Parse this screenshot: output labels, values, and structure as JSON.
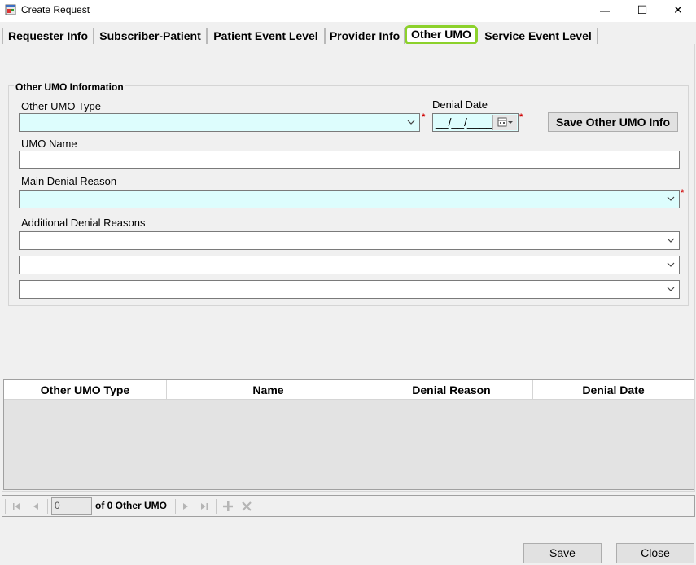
{
  "window": {
    "title": "Create Request",
    "minimize_glyph": "—",
    "maximize_glyph": "☐",
    "close_glyph": "✕"
  },
  "tabs": [
    {
      "label": "Requester Info"
    },
    {
      "label": "Subscriber-Patient"
    },
    {
      "label": "Patient Event Level"
    },
    {
      "label": "Provider Info"
    },
    {
      "label": "Other UMO",
      "active": true
    },
    {
      "label": "Service Event Level"
    }
  ],
  "form": {
    "group_title": "Other UMO Information",
    "other_umo_type_label": "Other UMO Type",
    "other_umo_type_value": "",
    "denial_date_label": "Denial Date",
    "denial_date_value": "__/__/____",
    "save_button": "Save Other UMO Info",
    "umo_name_label": "UMO Name",
    "umo_name_value": "",
    "main_denial_reason_label": "Main Denial Reason",
    "main_denial_reason_value": "",
    "additional_denial_reasons_label": "Additional Denial Reasons",
    "additional_denial_reasons": [
      "",
      "",
      ""
    ],
    "required_marker": "*"
  },
  "grid": {
    "columns": [
      "Other UMO Type",
      "Name",
      "Denial Reason",
      "Denial Date"
    ],
    "rows": []
  },
  "navigator": {
    "position": "0",
    "count_text": "of 0 Other UMO"
  },
  "buttons": {
    "save": "Save",
    "close": "Close"
  },
  "colors": {
    "required_field_bg": "#ddfdfd",
    "active_tab_highlight": "#8cd12b",
    "required_marker": "#d00000"
  }
}
